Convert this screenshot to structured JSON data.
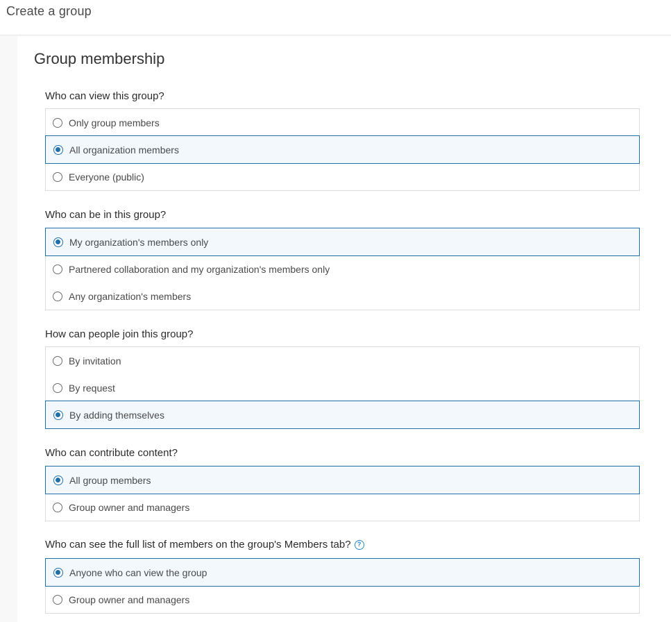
{
  "header": {
    "title": "Create a group"
  },
  "section": {
    "title": "Group membership"
  },
  "questions": [
    {
      "label": "Who can view this group?",
      "options": [
        {
          "label": "Only group members",
          "selected": false
        },
        {
          "label": "All organization members",
          "selected": true
        },
        {
          "label": "Everyone (public)",
          "selected": false
        }
      ]
    },
    {
      "label": "Who can be in this group?",
      "options": [
        {
          "label": "My organization's members only",
          "selected": true
        },
        {
          "label": "Partnered collaboration and my organization's members only",
          "selected": false
        },
        {
          "label": "Any organization's members",
          "selected": false
        }
      ]
    },
    {
      "label": "How can people join this group?",
      "options": [
        {
          "label": "By invitation",
          "selected": false
        },
        {
          "label": "By request",
          "selected": false
        },
        {
          "label": "By adding themselves",
          "selected": true
        }
      ]
    },
    {
      "label": "Who can contribute content?",
      "options": [
        {
          "label": "All group members",
          "selected": true
        },
        {
          "label": "Group owner and managers",
          "selected": false
        }
      ]
    },
    {
      "label": "Who can see the full list of members on the group's Members tab?",
      "help_icon": "help-circle-icon",
      "options": [
        {
          "label": "Anyone who can view the group",
          "selected": true
        },
        {
          "label": "Group owner and managers",
          "selected": false
        }
      ]
    }
  ],
  "colors": {
    "accent": "#1f6fa8",
    "selected_bg": "#f2f8fc",
    "border": "#dcdcdc"
  }
}
